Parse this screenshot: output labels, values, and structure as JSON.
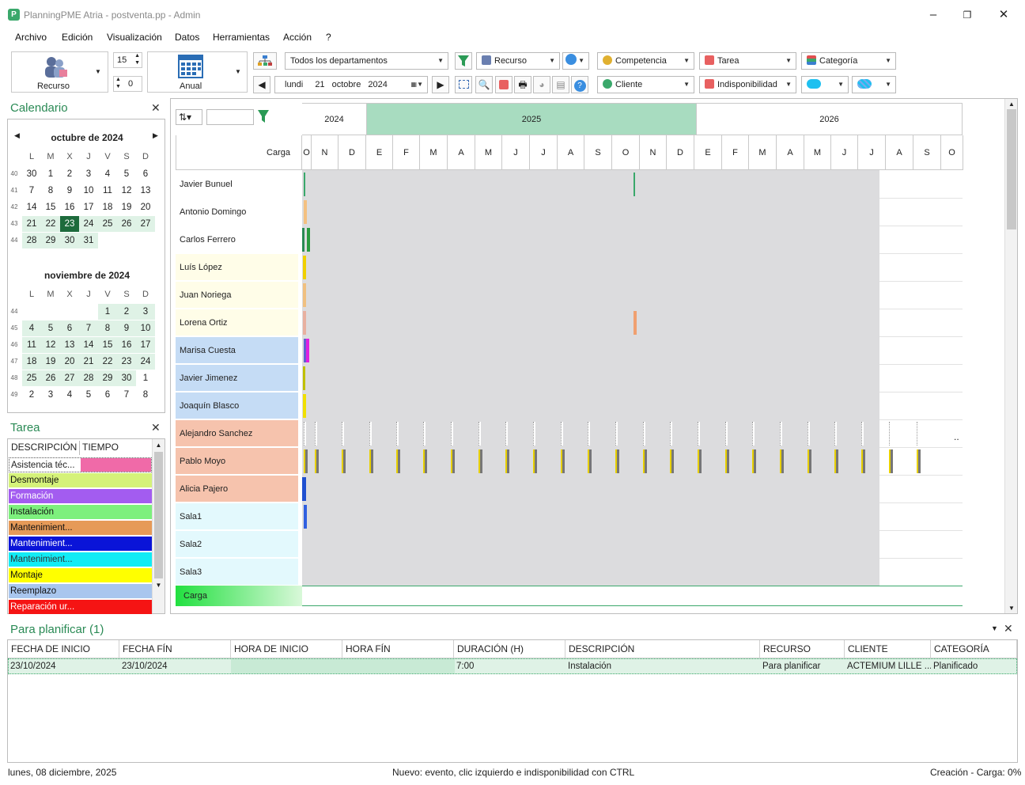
{
  "window": {
    "title": "PlanningPME Atria - postventa.pp - Admin",
    "icon_letter": "P"
  },
  "menu": [
    "Archivo",
    "Edición",
    "Visualización",
    "Datos",
    "Herramientas",
    "Acción",
    "?"
  ],
  "toolbar": {
    "resource_button": "Recurso",
    "spin_top": "15",
    "spin_bottom": "0",
    "view_button": "Anual",
    "department": "Todos los departamentos",
    "date_day": "lundi",
    "date_num": "21",
    "date_month": "octobre",
    "date_year": "2024",
    "combos": {
      "recurso": "Recurso",
      "competencia": "Competencia",
      "tarea": "Tarea",
      "categoria": "Categoría",
      "cliente": "Cliente",
      "indisponibilidad": "Indisponibilidad"
    }
  },
  "calendar_panel": {
    "title": "Calendario",
    "dow": [
      "L",
      "M",
      "X",
      "J",
      "V",
      "S",
      "D"
    ],
    "months": [
      {
        "name": "octubre de 2024",
        "weeks": [
          {
            "wk": "40",
            "days": [
              "30",
              "1",
              "2",
              "3",
              "4",
              "5",
              "6"
            ]
          },
          {
            "wk": "41",
            "days": [
              "7",
              "8",
              "9",
              "10",
              "11",
              "12",
              "13"
            ]
          },
          {
            "wk": "42",
            "days": [
              "14",
              "15",
              "16",
              "17",
              "18",
              "19",
              "20"
            ]
          },
          {
            "wk": "43",
            "days": [
              "21",
              "22",
              "23",
              "24",
              "25",
              "26",
              "27"
            ]
          },
          {
            "wk": "44",
            "days": [
              "28",
              "29",
              "30",
              "31",
              "",
              "",
              ""
            ]
          }
        ]
      },
      {
        "name": "noviembre de 2024",
        "weeks": [
          {
            "wk": "44",
            "days": [
              "",
              "",
              "",
              "",
              "1",
              "2",
              "3"
            ]
          },
          {
            "wk": "45",
            "days": [
              "4",
              "5",
              "6",
              "7",
              "8",
              "9",
              "10"
            ]
          },
          {
            "wk": "46",
            "days": [
              "11",
              "12",
              "13",
              "14",
              "15",
              "16",
              "17"
            ]
          },
          {
            "wk": "47",
            "days": [
              "18",
              "19",
              "20",
              "21",
              "22",
              "23",
              "24"
            ]
          },
          {
            "wk": "48",
            "days": [
              "25",
              "26",
              "27",
              "28",
              "29",
              "30",
              "1"
            ]
          },
          {
            "wk": "49",
            "days": [
              "2",
              "3",
              "4",
              "5",
              "6",
              "7",
              "8"
            ]
          }
        ]
      }
    ]
  },
  "task_panel": {
    "title": "Tarea",
    "col_desc": "DESCRIPCIÓN",
    "col_time": "TIEMPO",
    "items": [
      {
        "label": "Asistencia téc...",
        "color": "#f06aa8",
        "text": "#222"
      },
      {
        "label": "Desmontaje",
        "color": "#d5f27a",
        "text": "#111"
      },
      {
        "label": "Formación",
        "color": "#a35cf0",
        "text": "#fff"
      },
      {
        "label": "Instalación",
        "color": "#7df07d",
        "text": "#111"
      },
      {
        "label": "Mantenimient...",
        "color": "#e69a58",
        "text": "#111"
      },
      {
        "label": "Mantenimient...",
        "color": "#0a14d8",
        "text": "#fff"
      },
      {
        "label": "Mantenimient...",
        "color": "#12ecf5",
        "text": "#333"
      },
      {
        "label": "Montaje",
        "color": "#ffff00",
        "text": "#111"
      },
      {
        "label": "Reemplazo",
        "color": "#a9c6ee",
        "text": "#111"
      },
      {
        "label": "Reparación ur...",
        "color": "#f51414",
        "text": "#fff"
      }
    ]
  },
  "gantt": {
    "years": [
      "2024",
      "2025",
      "2026"
    ],
    "corner_label": "Carga",
    "months": [
      "O",
      "N",
      "D",
      "E",
      "F",
      "M",
      "A",
      "M",
      "J",
      "J",
      "A",
      "S",
      "O",
      "N",
      "D",
      "E",
      "F",
      "M",
      "A",
      "M",
      "J",
      "J",
      "A",
      "S",
      "O"
    ],
    "resources": [
      {
        "name": "Javier Bunuel",
        "bg": "#ffffff"
      },
      {
        "name": "Antonio Domingo",
        "bg": "#ffffff"
      },
      {
        "name": "Carlos Ferrero",
        "bg": "#ffffff"
      },
      {
        "name": "Luís López",
        "bg": "#fffde8"
      },
      {
        "name": "Juan Noriega",
        "bg": "#fffde8"
      },
      {
        "name": "Lorena Ortiz",
        "bg": "#fffde8"
      },
      {
        "name": "Marisa Cuesta",
        "bg": "#c5dcf5"
      },
      {
        "name": "Javier Jimenez",
        "bg": "#c5dcf5"
      },
      {
        "name": "Joaquín Blasco",
        "bg": "#c5dcf5"
      },
      {
        "name": "Alejandro Sanchez",
        "bg": "#f6c3ad"
      },
      {
        "name": "Pablo Moyo",
        "bg": "#f6c3ad"
      },
      {
        "name": "Alicia Pajero",
        "bg": "#f6c3ad"
      },
      {
        "name": "Sala1",
        "bg": "#e3f9fd"
      },
      {
        "name": "Sala2",
        "bg": "#e3f9fd"
      },
      {
        "name": "Sala3",
        "bg": "#e3f9fd"
      }
    ],
    "load_row": "Carga"
  },
  "plan_panel": {
    "title": "Para planificar (1)",
    "columns": [
      "FECHA DE INICIO",
      "FECHA FÍN",
      "HORA DE INICIO",
      "HORA FÍN",
      "DURACIÓN (H)",
      "DESCRIPCIÓN",
      "RECURSO",
      "CLIENTE",
      "CATEGORÍA"
    ],
    "rows": [
      [
        "23/10/2024",
        "23/10/2024",
        "",
        "",
        "7:00",
        "Instalación",
        "Para planificar",
        "ACTEMIUM LILLE ...",
        "Planificado"
      ]
    ]
  },
  "status": {
    "left": "lunes, 08 diciembre, 2025",
    "center": "Nuevo: evento, clic izquierdo e indisponibilidad con CTRL",
    "right": "Creación - Carga: 0%"
  },
  "colors": {
    "accent": "#2a8a55",
    "header_2025": "#a8dcc0",
    "grid_gray": "#dcdcde"
  }
}
